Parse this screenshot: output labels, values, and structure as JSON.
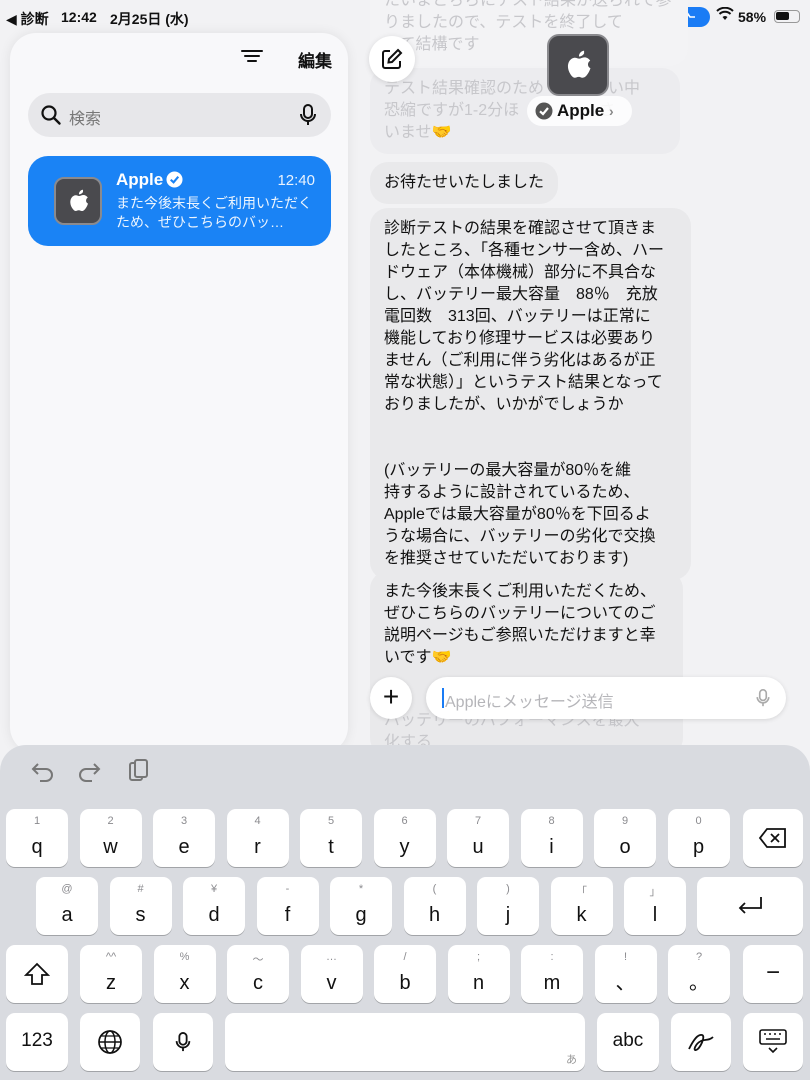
{
  "status_bar": {
    "back_label": "◀ 診断",
    "time": "12:42",
    "date": "2月25日 (水)",
    "battery_pct": "58%",
    "battery_level": 0.58
  },
  "sidebar": {
    "edit_label": "編集",
    "search_placeholder": "検索",
    "conversation": {
      "name": "Apple",
      "time": "12:40",
      "preview": "また今後末長くご利用いただくため、ぜひこちらのバッ…"
    }
  },
  "chat": {
    "contact_name": "Apple",
    "faded_top": "たいまとちらにテスト結果が送られて参りましたので、テストを終了して\nいて結構です",
    "faded_second": "テスト結果確認のため　　　しい中\n恐縮ですが1-2分ほ　　　　　さ\nいませ🤝",
    "messages": [
      {
        "text": "お待たせいたしました"
      },
      {
        "text": "診断テストの結果を確認させて頂きま\nしたところ、「各種センサー含め、ハー\nドウェア（本体機械）部分に不具合な\nし、バッテリー最大容量　88％　充放\n電回数　313回、バッテリーは正常に\n機能しており修理サービスは必要あり\nません（ご利用に伴う劣化はあるが正\n常な状態）」というテスト結果となって\nおりましたが、いかがでしょうか\n\n\n(バッテリーの最大容量が80％を維\n持するように設計されているため、\nAppleでは最大容量が80％を下回るよ\nうな場合に、バッテリーの劣化で交換\nを推奨させていただいております)"
      },
      {
        "text": "また今後末長くご利用いただくため、\nぜひこちらのバッテリーについてのご\n説明ページもご参照いただけますと幸\nいです🤝"
      }
    ],
    "faded_bottom": "バッテリーのパフォーマンスを最大\n化する",
    "input_placeholder": "Appleにメッセージ送信"
  },
  "keyboard": {
    "row1": [
      {
        "sub": "1",
        "main": "q"
      },
      {
        "sub": "2",
        "main": "w"
      },
      {
        "sub": "3",
        "main": "e"
      },
      {
        "sub": "4",
        "main": "r"
      },
      {
        "sub": "5",
        "main": "t"
      },
      {
        "sub": "6",
        "main": "y"
      },
      {
        "sub": "7",
        "main": "u"
      },
      {
        "sub": "8",
        "main": "i"
      },
      {
        "sub": "9",
        "main": "o"
      },
      {
        "sub": "0",
        "main": "p"
      }
    ],
    "row2": [
      {
        "sub": "@",
        "main": "a"
      },
      {
        "sub": "#",
        "main": "s"
      },
      {
        "sub": "¥",
        "main": "d"
      },
      {
        "sub": "-",
        "main": "f"
      },
      {
        "sub": "*",
        "main": "g"
      },
      {
        "sub": "(",
        "main": "h"
      },
      {
        "sub": ")",
        "main": "j"
      },
      {
        "sub": "「",
        "main": "k"
      },
      {
        "sub": "」",
        "main": "l"
      }
    ],
    "row3": [
      {
        "sub": "^^",
        "main": "z"
      },
      {
        "sub": "%",
        "main": "x"
      },
      {
        "sub": "〜",
        "main": "c"
      },
      {
        "sub": "…",
        "main": "v"
      },
      {
        "sub": "/",
        "main": "b"
      },
      {
        "sub": ";",
        "main": "n"
      },
      {
        "sub": ":",
        "main": "m"
      },
      {
        "sub": "!",
        "main": "、"
      },
      {
        "sub": "?",
        "main": "。"
      }
    ],
    "dash_label": "−",
    "numbers_label": "123",
    "abc_label": "abc",
    "space_hint": "あ"
  }
}
